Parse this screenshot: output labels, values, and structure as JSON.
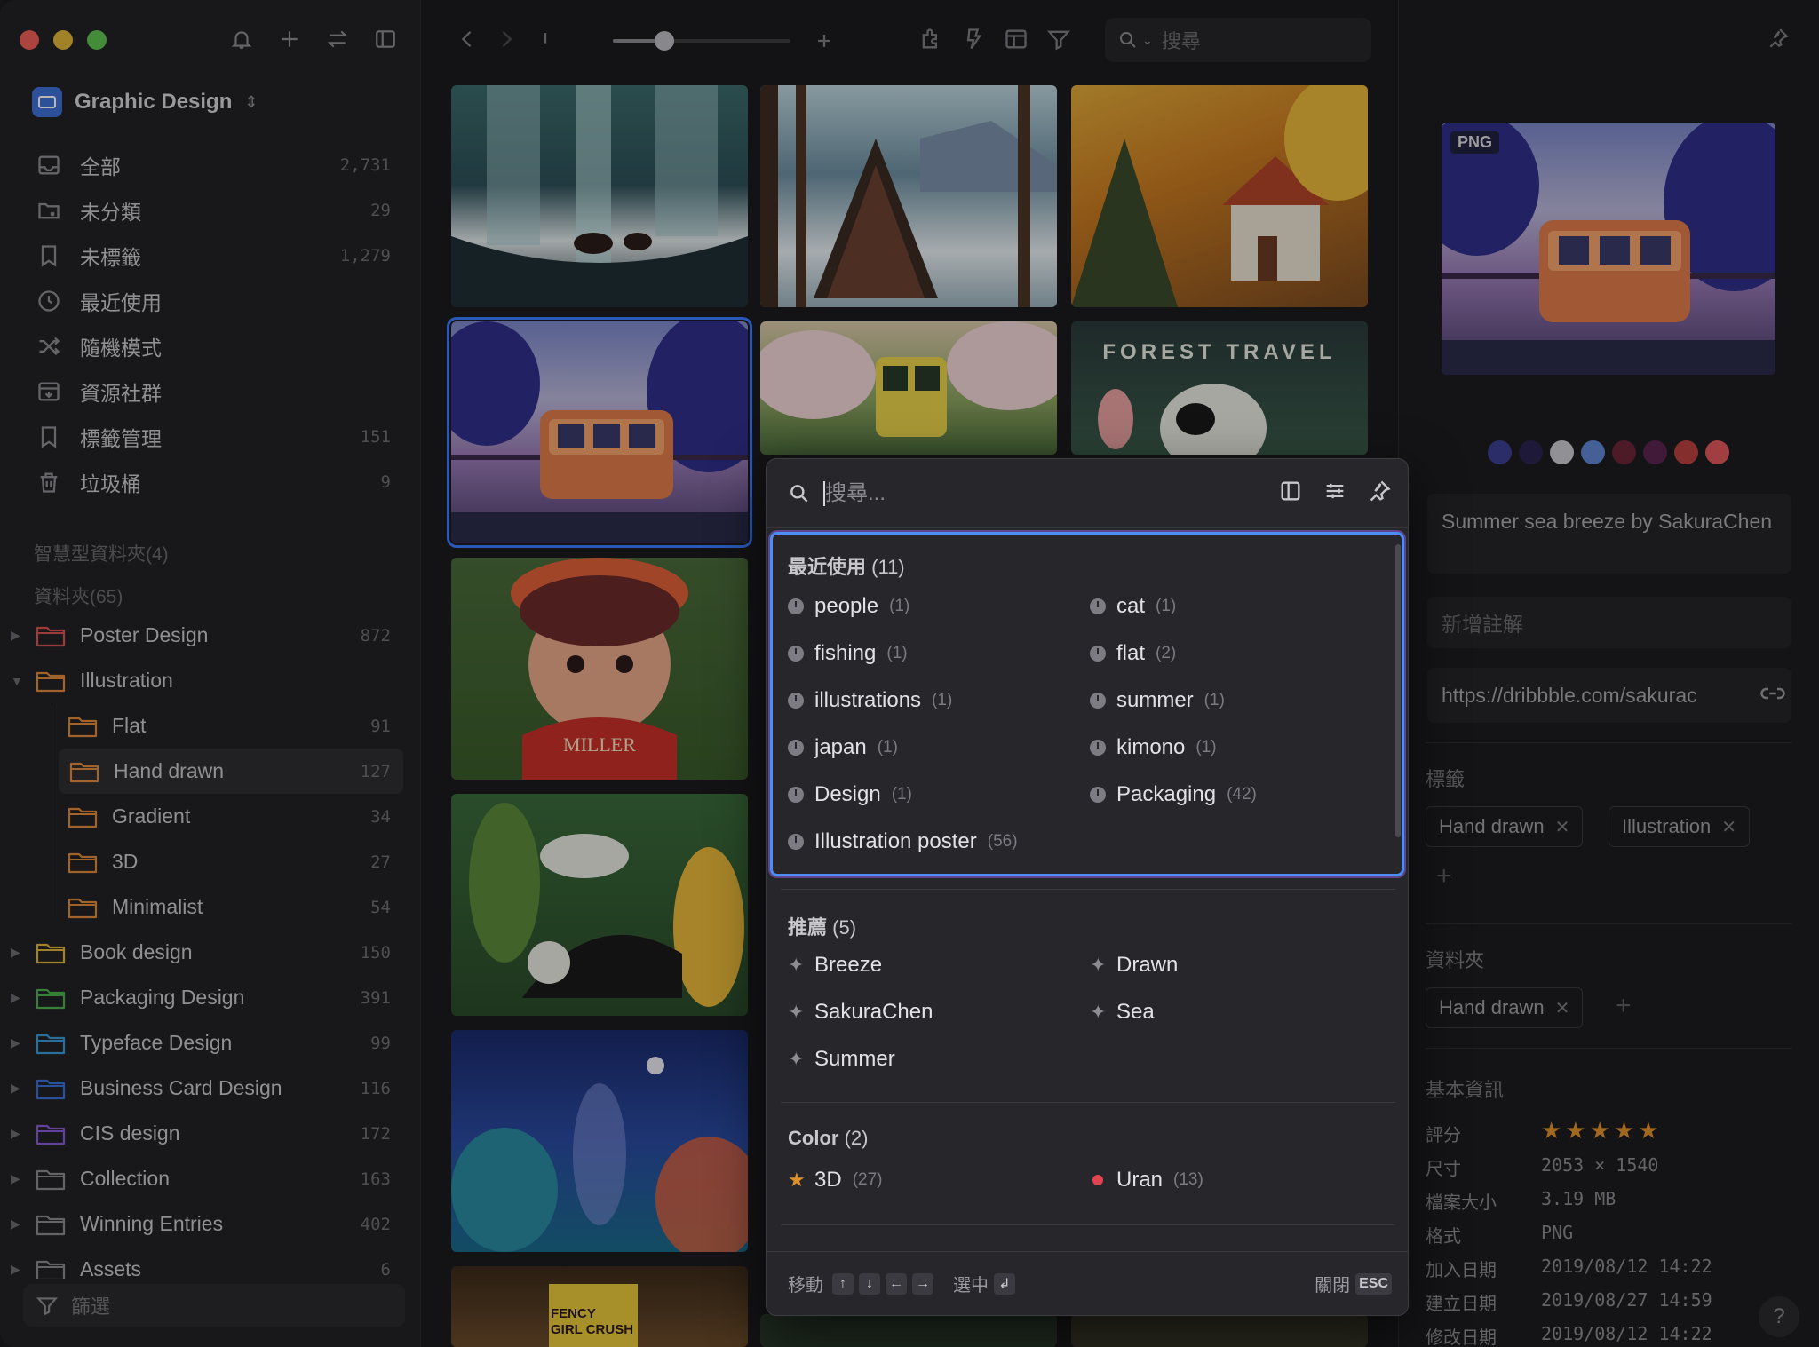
{
  "sidebar": {
    "library_name": "Graphic Design",
    "nav": [
      {
        "label": "全部",
        "count": "2,731",
        "icon": "inbox-icon"
      },
      {
        "label": "未分類",
        "count": "29",
        "icon": "unfiled-folder-icon"
      },
      {
        "label": "未標籤",
        "count": "1,279",
        "icon": "untagged-icon"
      },
      {
        "label": "最近使用",
        "count": "",
        "icon": "clock-icon"
      },
      {
        "label": "隨機模式",
        "count": "",
        "icon": "shuffle-icon"
      },
      {
        "label": "資源社群",
        "count": "",
        "icon": "community-icon"
      },
      {
        "label": "標籤管理",
        "count": "151",
        "icon": "bookmark-icon"
      },
      {
        "label": "垃圾桶",
        "count": "9",
        "icon": "trash-icon"
      }
    ],
    "smart_folders_label": "智慧型資料夾(4)",
    "folders_label": "資料夾(65)",
    "folders": [
      {
        "label": "Poster Design",
        "count": "872",
        "color": "#d9534f",
        "level": 0,
        "expanded": false
      },
      {
        "label": "Illustration",
        "count": "",
        "color": "#e08a3a",
        "level": 0,
        "expanded": true
      },
      {
        "label": "Flat",
        "count": "91",
        "color": "#e08a3a",
        "level": 1
      },
      {
        "label": "Hand drawn",
        "count": "127",
        "color": "#e08a3a",
        "level": 1,
        "selected": true
      },
      {
        "label": "Gradient",
        "count": "34",
        "color": "#e08a3a",
        "level": 1
      },
      {
        "label": "3D",
        "count": "27",
        "color": "#e08a3a",
        "level": 1
      },
      {
        "label": "Minimalist",
        "count": "54",
        "color": "#e08a3a",
        "level": 1
      },
      {
        "label": "Book design",
        "count": "150",
        "color": "#e0b43a",
        "level": 0,
        "expanded": false
      },
      {
        "label": "Packaging Design",
        "count": "391",
        "color": "#4caf50",
        "level": 0,
        "expanded": false
      },
      {
        "label": "Typeface Design",
        "count": "99",
        "color": "#3a9ad9",
        "level": 0,
        "expanded": false
      },
      {
        "label": "Business Card Design",
        "count": "116",
        "color": "#3a6fd9",
        "level": 0,
        "expanded": false
      },
      {
        "label": "CIS design",
        "count": "172",
        "color": "#8a5ad9",
        "level": 0,
        "expanded": false
      },
      {
        "label": "Collection",
        "count": "163",
        "color": "#8a8a90",
        "level": 0,
        "expanded": false
      },
      {
        "label": "Winning Entries",
        "count": "402",
        "color": "#8a8a90",
        "level": 0,
        "expanded": false
      },
      {
        "label": "Assets",
        "count": "6",
        "color": "#8a8a90",
        "level": 0,
        "expanded": false
      }
    ],
    "filter_label": "篩選"
  },
  "toolbar": {
    "search_placeholder": "搜尋",
    "zoom_level": 0.29
  },
  "grid": {
    "thumbs": [
      {
        "name": "waterfall-bears-illustration"
      },
      {
        "name": "snowy-cabin-illustration"
      },
      {
        "name": "autumn-house-illustration"
      },
      {
        "name": "summer-sea-breeze-illustration",
        "selected": true
      },
      {
        "name": "cherry-blossom-train-illustration"
      },
      {
        "name": "forest-travel-poster",
        "text": "FOREST TRAVEL"
      },
      {
        "name": "flower-girl-illustration",
        "text": "MILLER"
      },
      {
        "name": "jungle-cat-illustration"
      },
      {
        "name": "night-forest-illustration"
      },
      {
        "name": "fency-girl-crush-poster",
        "text": "FENCY GIRL CRUSH"
      }
    ]
  },
  "popup": {
    "search_placeholder": "搜尋...",
    "recent": {
      "title": "最近使用",
      "count": "(11)",
      "items": [
        {
          "label": "people",
          "count": "(1)"
        },
        {
          "label": "cat",
          "count": "(1)"
        },
        {
          "label": "fishing",
          "count": "(1)"
        },
        {
          "label": "flat",
          "count": "(2)"
        },
        {
          "label": "illustrations",
          "count": "(1)"
        },
        {
          "label": "summer",
          "count": "(1)"
        },
        {
          "label": "japan",
          "count": "(1)"
        },
        {
          "label": "kimono",
          "count": "(1)"
        },
        {
          "label": "Design",
          "count": "(1)"
        },
        {
          "label": "Packaging",
          "count": "(42)"
        },
        {
          "label": "Illustration poster",
          "count": "(56)"
        }
      ]
    },
    "recommend": {
      "title": "推薦",
      "count": "(5)",
      "items": [
        {
          "label": "Breeze"
        },
        {
          "label": "Drawn"
        },
        {
          "label": "SakuraChen"
        },
        {
          "label": "Sea"
        },
        {
          "label": "Summer"
        }
      ]
    },
    "color": {
      "title": "Color",
      "count": "(2)",
      "items": [
        {
          "label": "3D",
          "count": "(27)",
          "marker": "star"
        },
        {
          "label": "Uran",
          "count": "(13)",
          "marker": "red-dot"
        }
      ]
    },
    "footer": {
      "move_label": "移動",
      "keys": [
        "↑",
        "↓",
        "←",
        "→"
      ],
      "select_label": "選中",
      "select_key": "↲",
      "close_label": "關閉",
      "close_key": "ESC"
    }
  },
  "inspector": {
    "format_badge": "PNG",
    "palette": [
      "#3b3f8f",
      "#2b2350",
      "#c9c9cf",
      "#5f86d0",
      "#6b2438",
      "#5a2450",
      "#b8423f",
      "#e0565a"
    ],
    "title": "Summer sea breeze by SakuraChen",
    "note_placeholder": "新增註解",
    "url": "https://dribbble.com/sakurac",
    "tags_label": "標籤",
    "tags": [
      "Hand drawn",
      "Illustration"
    ],
    "folders_label": "資料夾",
    "folders": [
      "Hand drawn"
    ],
    "basic_info_label": "基本資訊",
    "rating_label": "評分",
    "rating": 5,
    "rating_stars": "★★★★★",
    "meta": [
      {
        "label": "尺寸",
        "value": "2053 × 1540"
      },
      {
        "label": "檔案大小",
        "value": "3.19 MB"
      },
      {
        "label": "格式",
        "value": "PNG"
      },
      {
        "label": "加入日期",
        "value": "2019/08/12 14:22"
      },
      {
        "label": "建立日期",
        "value": "2019/08/27 14:59"
      },
      {
        "label": "修改日期",
        "value": "2019/08/12 14:22"
      }
    ]
  }
}
